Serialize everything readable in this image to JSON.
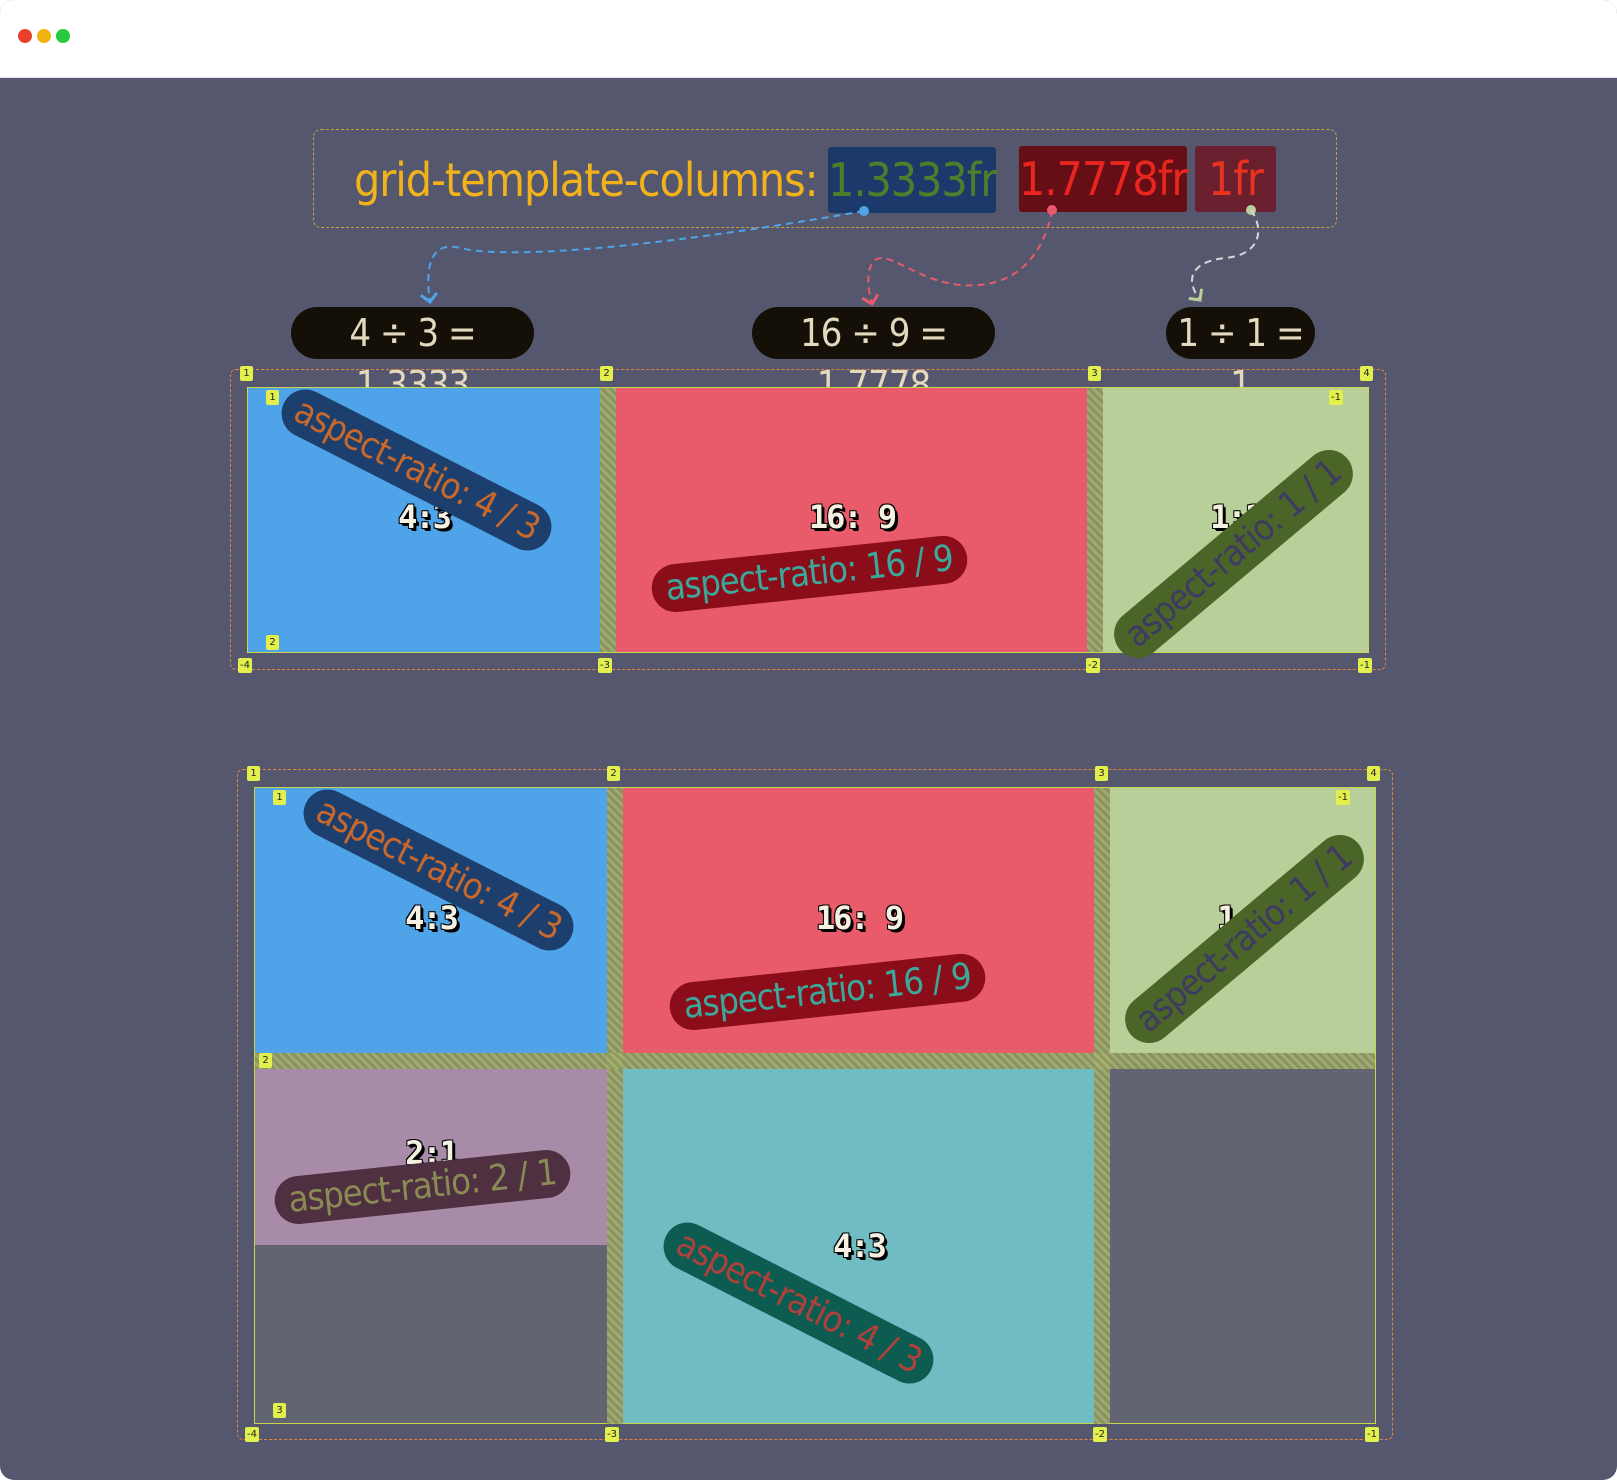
{
  "window": {
    "controls": [
      "close",
      "minimize",
      "zoom"
    ],
    "colors": {
      "close": "#e8402c",
      "minimize": "#f2b20e",
      "zoom": "#27c93f",
      "background": "#55576f"
    }
  },
  "code": {
    "property": "grid-template-columns:",
    "tokens": [
      "1.3333fr",
      "1.7778fr",
      "1fr"
    ]
  },
  "calculations": [
    "4 ÷ 3 = 1.3333",
    "16 ÷ 9 = 1.7778",
    "1 ÷ 1 = 1"
  ],
  "grid1": {
    "cells": [
      {
        "ratio": "4:3",
        "label": "aspect-ratio: 4 / 3",
        "color": "#4fa3e8"
      },
      {
        "ratio": "16: 9",
        "label": "aspect-ratio: 16 / 9",
        "color": "#e95a6a"
      },
      {
        "ratio": "1:1",
        "label": "aspect-ratio: 1 / 1",
        "color": "#b8cf9a"
      }
    ],
    "column_lines": [
      "1",
      "2",
      "3",
      "4"
    ],
    "column_lines_negative": [
      "-4",
      "-3",
      "-2",
      "-1"
    ],
    "row_lines": [
      "1",
      "2"
    ],
    "row_lines_negative": [
      "-1"
    ]
  },
  "grid2": {
    "cells": [
      {
        "ratio": "4:3",
        "label": "aspect-ratio: 4 / 3",
        "color": "#4fa3e8"
      },
      {
        "ratio": "16: 9",
        "label": "aspect-ratio: 16 / 9",
        "color": "#e95a6a"
      },
      {
        "ratio": "1:1",
        "label": "aspect-ratio: 1 / 1",
        "color": "#b8cf9a"
      },
      {
        "ratio": "2:1",
        "label": "aspect-ratio: 2 / 1",
        "color": "#a88ba8"
      },
      {
        "ratio": "4:3",
        "label": "aspect-ratio: 4 / 3",
        "color": "#6fbdc2"
      }
    ],
    "column_lines": [
      "1",
      "2",
      "3",
      "4"
    ],
    "column_lines_negative": [
      "-4",
      "-3",
      "-2",
      "-1"
    ],
    "row_lines": [
      "1",
      "2",
      "3"
    ],
    "row_lines_negative": [
      "-1"
    ]
  }
}
